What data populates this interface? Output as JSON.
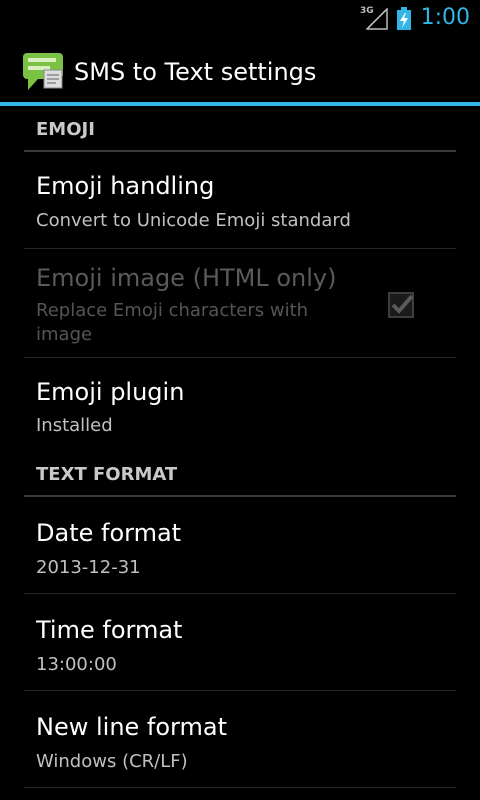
{
  "status": {
    "network": "3G",
    "time": "1:00"
  },
  "action_bar": {
    "title": "SMS to Text settings",
    "icon": "sms-to-text-app-icon"
  },
  "sections": [
    {
      "header": "EMOJI",
      "items": [
        {
          "title": "Emoji handling",
          "summary": "Convert to Unicode Emoji standard",
          "enabled": true
        },
        {
          "title": "Emoji image (HTML only)",
          "summary": "Replace Emoji characters with image",
          "enabled": false,
          "checkbox": true,
          "checked": true
        },
        {
          "title": "Emoji plugin",
          "summary": "Installed",
          "enabled": true
        }
      ]
    },
    {
      "header": "TEXT FORMAT",
      "items": [
        {
          "title": "Date format",
          "summary": "2013-12-31",
          "enabled": true
        },
        {
          "title": "Time format",
          "summary": "13:00:00",
          "enabled": true
        },
        {
          "title": "New line format",
          "summary": "Windows (CR/LF)",
          "enabled": true
        }
      ]
    }
  ],
  "colors": {
    "accent": "#33b5e5",
    "background": "#000000"
  }
}
